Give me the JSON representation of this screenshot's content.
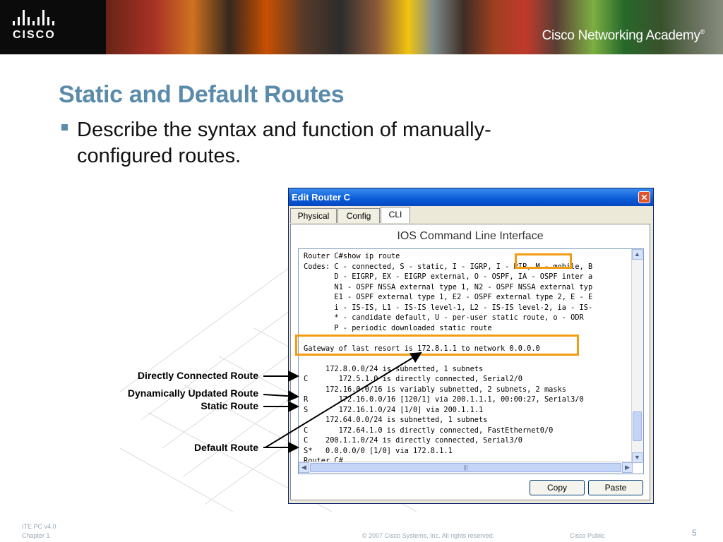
{
  "banner": {
    "logo_text": "CISCO",
    "academy_text": "Cisco Networking Academy",
    "academy_mark": "®"
  },
  "slide": {
    "title": "Static and Default Routes",
    "bullet": "Describe the syntax and function of manually-configured routes."
  },
  "window": {
    "title": "Edit Router C",
    "close_glyph": "✕",
    "tabs": [
      {
        "label": "Physical",
        "active": false
      },
      {
        "label": "Config",
        "active": false
      },
      {
        "label": "CLI",
        "active": true
      }
    ],
    "panel_heading": "IOS Command Line Interface",
    "terminal_lines": [
      "Router C#show ip route",
      "Codes: C - connected, S - static, I - IGRP, I - RIP, M - mobile, B",
      "       D - EIGRP, EX - EIGRP external, O - OSPF, IA - OSPF inter a",
      "       N1 - OSPF NSSA external type 1, N2 - OSPF NSSA external typ",
      "       E1 - OSPF external type 1, E2 - OSPF external type 2, E - E",
      "       i - IS-IS, L1 - IS-IS level-1, L2 - IS-IS level-2, ia - IS-",
      "       * - candidate default, U - per-user static route, o - ODR",
      "       P - periodic downloaded static route",
      "",
      "Gateway of last resort is 172.8.1.1 to network 0.0.0.0",
      "",
      "     172.8.0.0/24 is subnetted, 1 subnets",
      "C       172.5.1.0 is directly connected, Serial2/0",
      "     172.16.0.0/16 is variably subnetted, 2 subnets, 2 masks",
      "R       172.16.0.0/16 [120/1] via 200.1.1.1, 00:00:27, Serial3/0",
      "S       172.16.1.0/24 [1/0] via 200.1.1.1",
      "     172.64.0.0/24 is subnetted, 1 subnets",
      "C       172.64.1.0 is directly connected, FastEthernet0/0",
      "C    200.1.1.0/24 is directly connected, Serial3/0",
      "S*   0.0.0.0/0 [1/0] via 172.8.1.1",
      "Router C#"
    ],
    "scroll_up_glyph": "▲",
    "scroll_down_glyph": "▼",
    "scroll_left_glyph": "◀",
    "scroll_right_glyph": "▶",
    "h_thumb_grip": "|||",
    "copy_button": "Copy",
    "paste_button": "Paste"
  },
  "callouts": {
    "connected": "Directly Connected Route",
    "dynamic": "Dynamically Updated Route",
    "static": "Static Route",
    "default": "Default Route"
  },
  "footer": {
    "course": "ITE PC v4.0",
    "chapter": "Chapter 1",
    "copyright": "© 2007 Cisco Systems, Inc. All rights reserved.",
    "classification": "Cisco Public",
    "page_number": "5"
  },
  "colors": {
    "title": "#5b8bab",
    "highlight": "#f39c12",
    "window_titlebar": "#0a5bd6"
  }
}
